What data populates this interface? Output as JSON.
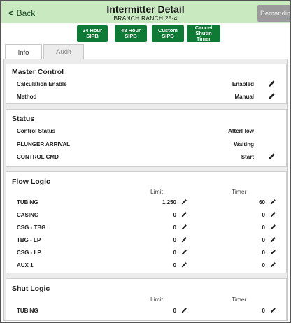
{
  "header": {
    "back_label": "Back",
    "title": "Intermitter Detail",
    "subtitle": "BRANCH RANCH 25-4",
    "demand_label": "Demandin"
  },
  "actions": [
    {
      "label": "24 Hour\nSIPB"
    },
    {
      "label": "48 Hour\nSIPB"
    },
    {
      "label": "Custom\nSIPB"
    },
    {
      "label": "Cancel\nShutin\nTimer"
    }
  ],
  "tabs": [
    {
      "label": "Info",
      "active": true
    },
    {
      "label": "Audit",
      "active": false
    }
  ],
  "master_control": {
    "title": "Master Control",
    "rows": [
      {
        "label": "Calculation Enable",
        "value": "Enabled"
      },
      {
        "label": "Method",
        "value": "Manual"
      }
    ]
  },
  "status": {
    "title": "Status",
    "rows": [
      {
        "label": "Control Status",
        "value": "AfterFlow"
      },
      {
        "label": "PLUNGER ARRIVAL",
        "value": "Waiting"
      },
      {
        "label": "CONTROL CMD",
        "value": "Start"
      }
    ]
  },
  "flow_logic": {
    "title": "Flow Logic",
    "limit_header": "Limit",
    "timer_header": "Timer",
    "rows": [
      {
        "label": "TUBING",
        "limit": "1,250",
        "timer": "60"
      },
      {
        "label": "CASING",
        "limit": "0",
        "timer": "0"
      },
      {
        "label": "CSG - TBG",
        "limit": "0",
        "timer": "0"
      },
      {
        "label": "TBG - LP",
        "limit": "0",
        "timer": "0"
      },
      {
        "label": "CSG - LP",
        "limit": "0",
        "timer": "0"
      },
      {
        "label": "AUX 1",
        "limit": "0",
        "timer": "0"
      }
    ]
  },
  "shut_logic": {
    "title": "Shut Logic",
    "limit_header": "Limit",
    "timer_header": "Timer",
    "rows": [
      {
        "label": "TUBING",
        "limit": "0",
        "timer": "0"
      }
    ]
  },
  "icons": {
    "edit": "pencil-icon",
    "back": "chevron-left-icon"
  },
  "colors": {
    "header_bg": "#c9e9c0",
    "action_green": "#0f7a35",
    "demand_gray": "#9a9a9a"
  }
}
